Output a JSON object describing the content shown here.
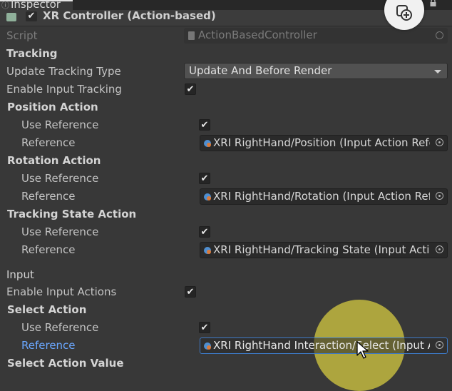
{
  "window": {
    "tab_title": "Inspector"
  },
  "component": {
    "title": "XR Controller (Action-based)",
    "enabled": true
  },
  "script": {
    "label": "Script",
    "value": "ActionBasedController"
  },
  "tracking": {
    "header": "Tracking",
    "update_type_label": "Update Tracking Type",
    "update_type_value": "Update And Before Render",
    "enable_label": "Enable Input Tracking",
    "enable_checked": true
  },
  "position_action": {
    "header": "Position Action",
    "use_reference_label": "Use Reference",
    "reference_label": "Reference",
    "reference_value": "XRI RightHand/Position (Input Action Refere"
  },
  "rotation_action": {
    "header": "Rotation Action",
    "use_reference_label": "Use Reference",
    "reference_label": "Reference",
    "reference_value": "XRI RightHand/Rotation (Input Action Refer"
  },
  "tracking_state_action": {
    "header": "Tracking State Action",
    "use_reference_label": "Use Reference",
    "reference_label": "Reference",
    "reference_value": "XRI RightHand/Tracking State (Input Action"
  },
  "input": {
    "header": "Input",
    "enable_label": "Enable Input Actions",
    "enable_checked": true
  },
  "select_action": {
    "header": "Select Action",
    "use_reference_label": "Use Reference",
    "reference_label": "Reference",
    "reference_value": "XRI RightHand Interaction/Select (Input Act"
  },
  "select_action_value": {
    "header": "Select Action Value"
  },
  "checkmark": "✔",
  "colors": {
    "background": "#383838",
    "highlight": "#cec440",
    "focus_border": "#3d79c6",
    "label_blue": "#6aa7ff"
  },
  "icons": [
    "component-script-icon",
    "checkbox-icon",
    "lock-icon",
    "dropdown-arrow-icon",
    "input-action-asset-icon",
    "object-picker-icon",
    "mouse-cursor-icon"
  ]
}
